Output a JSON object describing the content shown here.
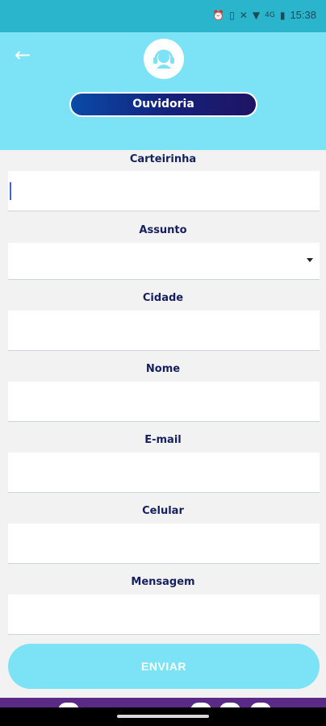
{
  "status_bar": {
    "time": "15:38",
    "icons": [
      "alarm-icon",
      "vibrate-icon",
      "nfc-icon",
      "wifi-icon",
      "signal-icon",
      "battery-icon"
    ],
    "network_label": "4G"
  },
  "header": {
    "back_icon": "arrow-left-icon",
    "logo_icon": "headset-icon",
    "title": "Ouvidoria"
  },
  "form": {
    "fields": [
      {
        "label": "Carteirinha",
        "value": "",
        "type": "text"
      },
      {
        "label": "Assunto",
        "value": "",
        "type": "select"
      },
      {
        "label": "Cidade",
        "value": "",
        "type": "text"
      },
      {
        "label": "Nome",
        "value": "",
        "type": "text"
      },
      {
        "label": "E-mail",
        "value": "",
        "type": "text"
      },
      {
        "label": "Celular",
        "value": "",
        "type": "text"
      },
      {
        "label": "Mensagem",
        "value": "",
        "type": "text"
      }
    ],
    "submit_label": "ENVIAR"
  },
  "colors": {
    "header_bg": "#7ce3f6",
    "status_bg": "#2bb5cc",
    "label_text": "#16205e",
    "pill_start": "#0a4aa8",
    "pill_end": "#1f1463",
    "bottom_bar": "#5b2a86"
  }
}
